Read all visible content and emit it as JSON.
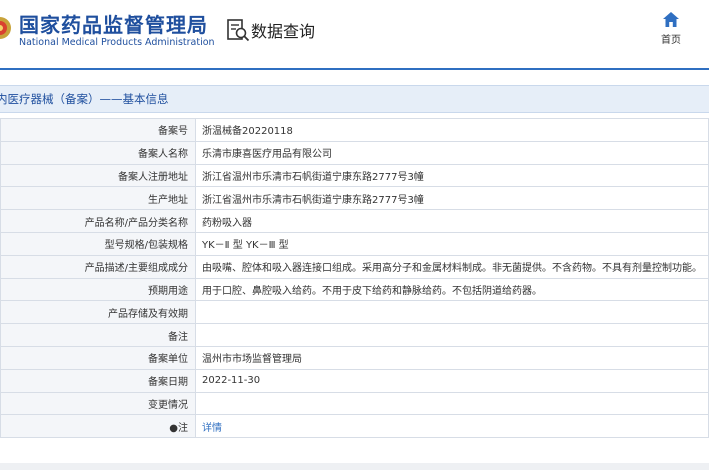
{
  "header": {
    "site_title_cn": "国家药品监督管理局",
    "site_title_en": "National Medical Products Administration",
    "query_label": "数据查询",
    "home_label": "首页",
    "accent_color": "#1f4f9e"
  },
  "section": {
    "title": "内医疗器械（备案）——基本信息"
  },
  "rows": [
    {
      "label": "备案号",
      "value": "浙温械备20220118"
    },
    {
      "label": "备案人名称",
      "value": "乐清市康喜医疗用品有限公司"
    },
    {
      "label": "备案人注册地址",
      "value": "浙江省温州市乐清市石帆街道宁康东路2777号3幢"
    },
    {
      "label": "生产地址",
      "value": "浙江省温州市乐清市石帆街道宁康东路2777号3幢"
    },
    {
      "label": "产品名称/产品分类名称",
      "value": "药粉吸入器"
    },
    {
      "label": "型号规格/包装规格",
      "value": "YK－Ⅱ 型 YK－Ⅲ 型"
    },
    {
      "label": "产品描述/主要组成成分",
      "value": "由吸嘴、腔体和吸入器连接口组成。采用高分子和金属材料制成。非无菌提供。不含药物。不具有剂量控制功能。"
    },
    {
      "label": "预期用途",
      "value": "用于口腔、鼻腔吸入给药。不用于皮下给药和静脉给药。不包括阴道给药器。"
    },
    {
      "label": "产品存储及有效期",
      "value": ""
    },
    {
      "label": "备注",
      "value": ""
    },
    {
      "label": "备案单位",
      "value": "温州市市场监督管理局"
    },
    {
      "label": "备案日期",
      "value": "2022-11-30"
    },
    {
      "label": "变更情况",
      "value": ""
    },
    {
      "label": "●注",
      "value": "详情"
    }
  ]
}
